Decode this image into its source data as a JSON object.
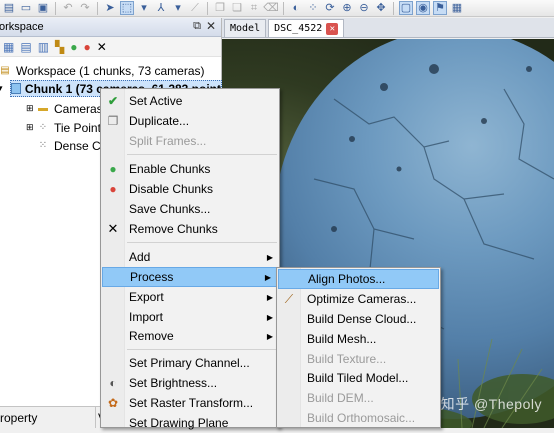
{
  "workspace": {
    "title": "orkspace",
    "root_label": "Workspace (1 chunks, 73 cameras)",
    "chunk_label": "Chunk 1 (73 cameras, 61,283 point",
    "children": [
      {
        "label": "Cameras (",
        "icon": "folder-icon"
      },
      {
        "label": "Tie Points",
        "icon": "tie-points-icon"
      },
      {
        "label": "Dense Clo",
        "icon": "dense-cloud-icon"
      }
    ]
  },
  "properties_bar": {
    "col1": "roperty",
    "col2": "V"
  },
  "tabs": [
    {
      "label": "Model",
      "active": false
    },
    {
      "label": "DSC_4522",
      "active": true
    }
  ],
  "watermark": "知乎 @Thepoly",
  "context_menu": {
    "items": [
      {
        "label": "Set Active",
        "icon": "checkmark-icon",
        "icon_color": "#2e9d3a",
        "disabled": false
      },
      {
        "label": "Duplicate...",
        "icon": "duplicate-icon",
        "disabled": false
      },
      {
        "label": "Split Frames...",
        "disabled": true
      },
      {
        "separator": true
      },
      {
        "label": "Enable Chunks",
        "icon": "enable-icon",
        "icon_color": "#3aa84b",
        "disabled": false
      },
      {
        "label": "Disable Chunks",
        "icon": "disable-icon",
        "icon_color": "#d9443a",
        "disabled": false
      },
      {
        "label": "Save Chunks...",
        "disabled": false
      },
      {
        "label": "Remove Chunks",
        "icon": "close-icon",
        "disabled": false
      },
      {
        "separator": true
      },
      {
        "label": "Add",
        "submenu": true
      },
      {
        "label": "Process",
        "submenu": true,
        "highlighted": true
      },
      {
        "label": "Export",
        "submenu": true
      },
      {
        "label": "Import",
        "submenu": true
      },
      {
        "label": "Remove",
        "submenu": true
      },
      {
        "separator": true
      },
      {
        "label": "Set Primary Channel..."
      },
      {
        "label": "Set Brightness...",
        "icon": "brightness-icon"
      },
      {
        "label": "Set Raster Transform...",
        "icon": "raster-transform-icon"
      },
      {
        "label": "Set Drawing Plane"
      }
    ]
  },
  "process_submenu": {
    "items": [
      {
        "label": "Align Photos...",
        "highlighted": true,
        "disabled": false
      },
      {
        "label": "Optimize Cameras...",
        "icon": "wand-icon",
        "disabled": false
      },
      {
        "label": "Build Dense Cloud...",
        "disabled": false
      },
      {
        "label": "Build Mesh...",
        "disabled": false
      },
      {
        "label": "Build Texture...",
        "disabled": true
      },
      {
        "label": "Build Tiled Model...",
        "disabled": false
      },
      {
        "label": "Build DEM...",
        "disabled": true
      },
      {
        "label": "Build Orthomosaic...",
        "disabled": true
      }
    ]
  },
  "colors": {
    "highlight": "#91c9f7",
    "chunk_selection": "#cde3fb",
    "close_tab": "#d9534f"
  }
}
